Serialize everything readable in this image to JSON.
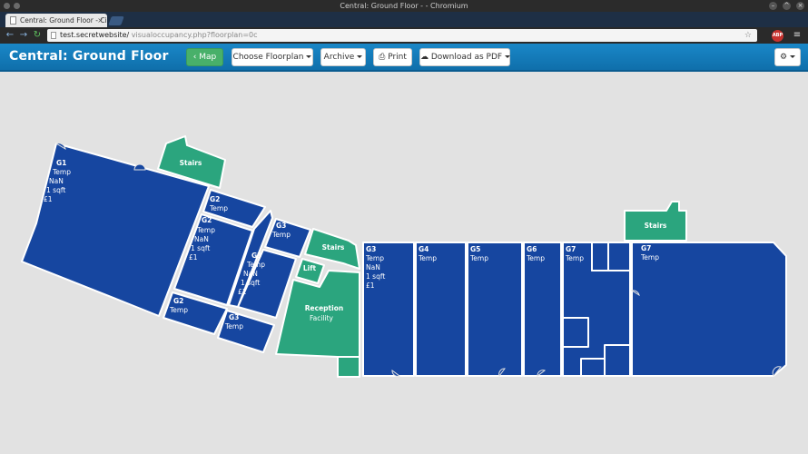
{
  "browser": {
    "window_title": "Central: Ground Floor - ",
    "window_title_suffix": " - Chromium",
    "tab_title": "Central: Ground Floor - Ci",
    "url_host": "test.secretwebsite/",
    "url_path": " visualoccupancy.php?floorplan=0c",
    "adblock_label": "ABP"
  },
  "app": {
    "title": "Central: Ground Floor",
    "buttons": {
      "map": "Map",
      "choose_floorplan": "Choose Floorplan",
      "archive": "Archive",
      "print": "Print",
      "download_pdf": "Download as PDF"
    }
  },
  "colors": {
    "room_blue": "#1646a0",
    "facility_green": "#2ba57e",
    "background": "#e2e2e2",
    "header_blue": "#1383c5"
  },
  "rooms": {
    "g1": {
      "name": "G1",
      "type": "Temp",
      "occupancy": "NaN",
      "area": "1 sqft",
      "cost": "£1"
    },
    "g2a": {
      "name": "G2",
      "type": "Temp"
    },
    "g2b": {
      "name": "G2",
      "type": "Temp",
      "occupancy": "NaN",
      "area": "1 sqft",
      "cost": "£1"
    },
    "g3a": {
      "name": "G3",
      "type": "Temp"
    },
    "g3b": {
      "name": "G3",
      "type": "Temp",
      "occupancy": "NaN",
      "area": "1 sqft",
      "cost": "£1"
    },
    "g2c": {
      "name": "G2",
      "type": "Temp"
    },
    "g3c": {
      "name": "G3",
      "type": "Temp"
    },
    "g3d": {
      "name": "G3",
      "type": "Temp",
      "occupancy": "NaN",
      "area": "1 sqft",
      "cost": "£1"
    },
    "g4": {
      "name": "G4",
      "type": "Temp"
    },
    "g5": {
      "name": "G5",
      "type": "Temp"
    },
    "g6": {
      "name": "G6",
      "type": "Temp"
    },
    "g7a": {
      "name": "G7",
      "type": "Temp"
    },
    "g7b": {
      "name": "G7",
      "type": "Temp"
    }
  },
  "facilities": {
    "stairs_left": "Stairs",
    "stairs_mid": "Stairs",
    "stairs_right": "Stairs",
    "lift": "Lift",
    "reception_name": "Reception",
    "reception_type": "Facility"
  }
}
